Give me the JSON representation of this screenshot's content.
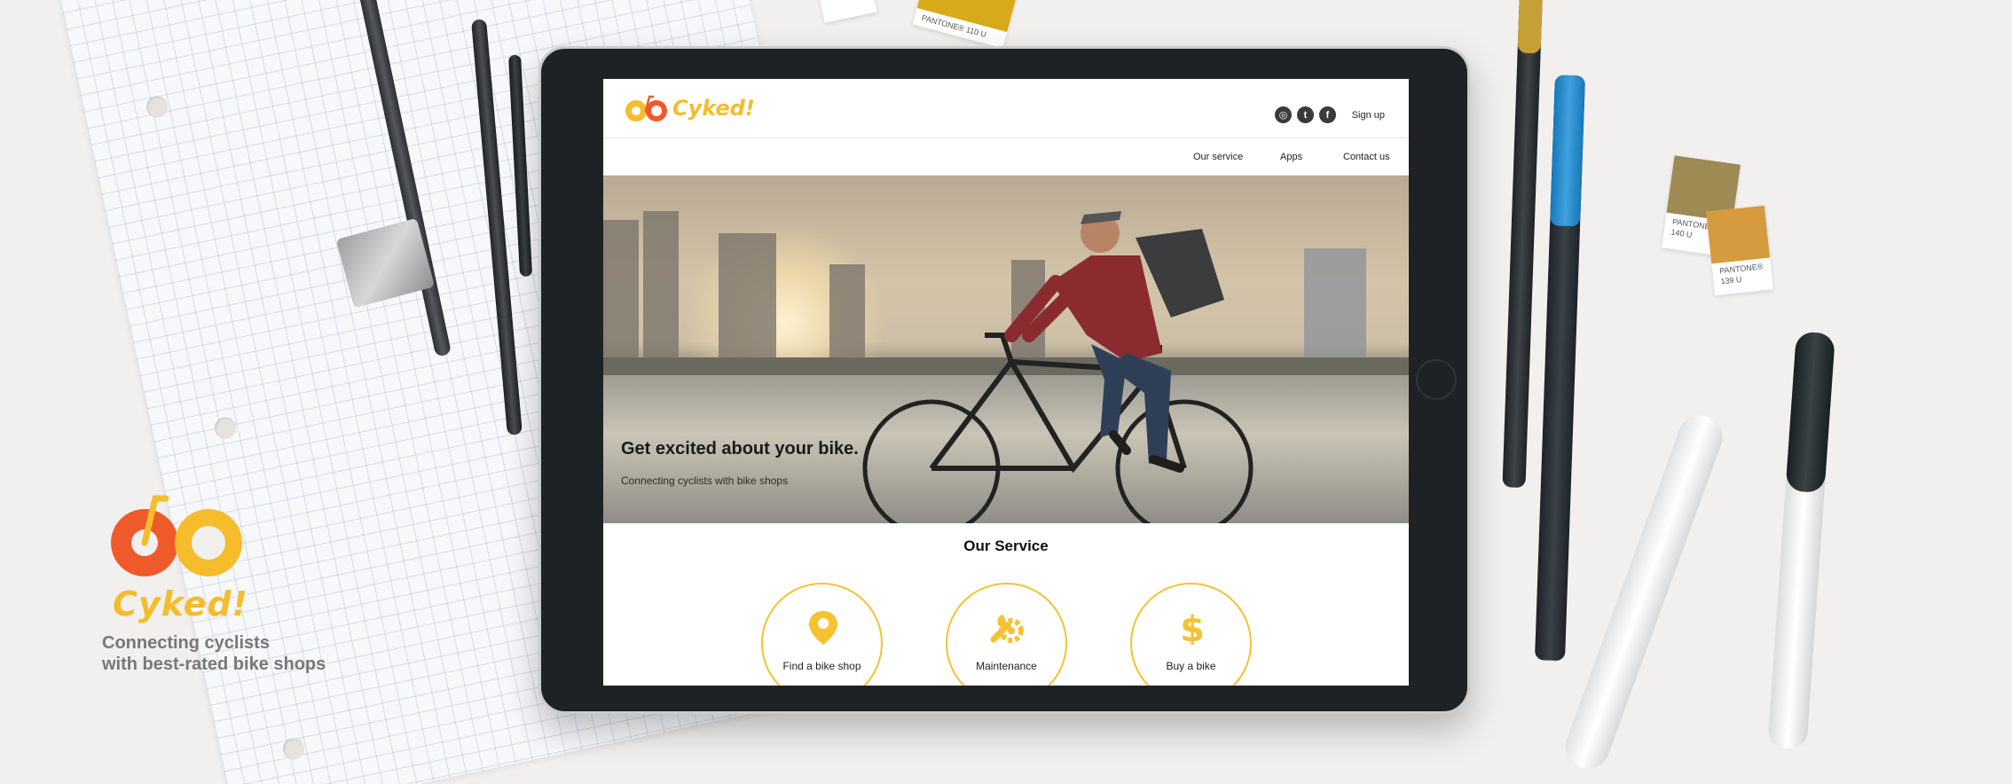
{
  "brand": {
    "name": "Cyked!",
    "tagline": "Connecting cyclists\nwith best-rated bike shops"
  },
  "site": {
    "logo_text": "Cyked!",
    "social": [
      {
        "name": "instagram-icon",
        "glyph": "◎"
      },
      {
        "name": "twitter-icon",
        "glyph": "t"
      },
      {
        "name": "facebook-icon",
        "glyph": "f"
      }
    ],
    "signup_label": "Sign up",
    "nav": [
      "Our service",
      "Apps",
      "Contact us"
    ],
    "hero": {
      "title": "Get excited about your bike.",
      "subtitle": "Connecting cyclists with bike shops"
    },
    "service": {
      "title": "Our Service",
      "items": [
        {
          "label": "Find a bike shop",
          "icon": "map-pin-icon"
        },
        {
          "label": "Maintenance",
          "icon": "wrench-gear-icon"
        },
        {
          "label": "Buy a bike",
          "icon": "dollar-icon"
        }
      ]
    }
  },
  "props": {
    "swatch_1": "PANTONE® 140 U",
    "swatch_2": "PANTONE® 139 U",
    "swatch_3": "PANTONE® 110 U"
  },
  "colors": {
    "accent_yellow": "#f5bc2c",
    "accent_orange": "#ef5a2b"
  }
}
